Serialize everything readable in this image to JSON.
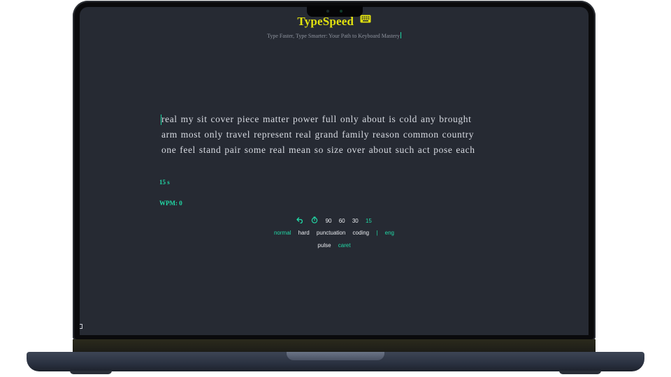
{
  "app": {
    "title": "TypeSpeed",
    "tagline": "Type Faster, Type Smarter: Your Path to Keyboard Mastery",
    "icon": "keyboard-icon"
  },
  "test": {
    "lines": [
      "real my sit cover piece matter power full only about is cold any brought",
      "arm most only travel represent real grand family reason common country",
      "one feel stand pair some real mean so size over about such act pose each"
    ],
    "timer": "15 s",
    "wpm": "WPM: 0"
  },
  "controls": {
    "restart_icon": "undo-arrow-icon",
    "timer_icon": "stopwatch-icon",
    "durations": [
      "90",
      "60",
      "30",
      "15"
    ],
    "active_duration": "15",
    "modes": [
      "normal",
      "hard",
      "punctuation",
      "coding"
    ],
    "active_mode": "normal",
    "separator": "|",
    "language": "eng",
    "caret_styles": [
      "pulse",
      "caret"
    ],
    "active_caret_style": "caret"
  },
  "colors": {
    "background": "#262a33",
    "accent": "#21d9a6",
    "title": "#e2e20f",
    "text": "#d8dbe2"
  }
}
